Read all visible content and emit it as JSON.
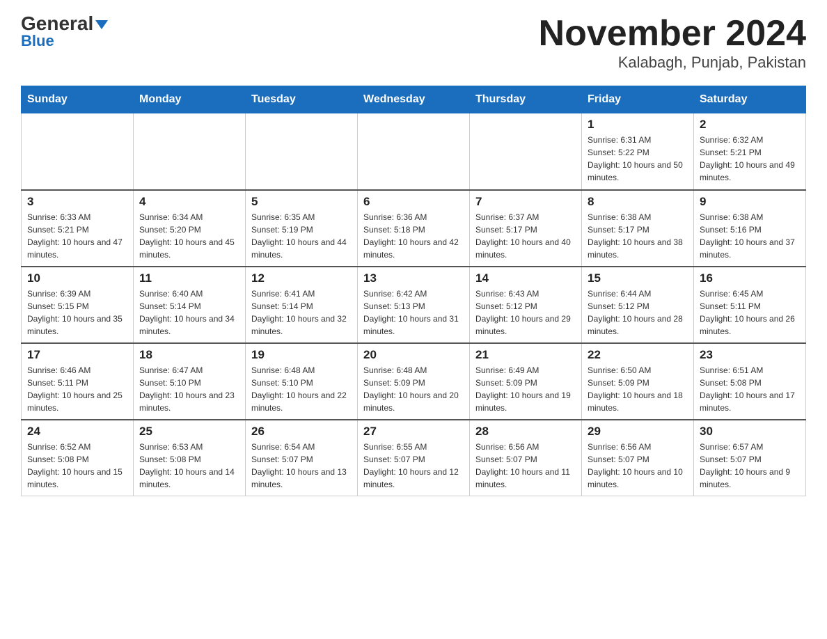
{
  "header": {
    "logo_general": "General",
    "logo_blue": "Blue",
    "title": "November 2024",
    "subtitle": "Kalabagh, Punjab, Pakistan"
  },
  "weekdays": [
    "Sunday",
    "Monday",
    "Tuesday",
    "Wednesday",
    "Thursday",
    "Friday",
    "Saturday"
  ],
  "weeks": [
    [
      {
        "day": "",
        "info": ""
      },
      {
        "day": "",
        "info": ""
      },
      {
        "day": "",
        "info": ""
      },
      {
        "day": "",
        "info": ""
      },
      {
        "day": "",
        "info": ""
      },
      {
        "day": "1",
        "info": "Sunrise: 6:31 AM\nSunset: 5:22 PM\nDaylight: 10 hours and 50 minutes."
      },
      {
        "day": "2",
        "info": "Sunrise: 6:32 AM\nSunset: 5:21 PM\nDaylight: 10 hours and 49 minutes."
      }
    ],
    [
      {
        "day": "3",
        "info": "Sunrise: 6:33 AM\nSunset: 5:21 PM\nDaylight: 10 hours and 47 minutes."
      },
      {
        "day": "4",
        "info": "Sunrise: 6:34 AM\nSunset: 5:20 PM\nDaylight: 10 hours and 45 minutes."
      },
      {
        "day": "5",
        "info": "Sunrise: 6:35 AM\nSunset: 5:19 PM\nDaylight: 10 hours and 44 minutes."
      },
      {
        "day": "6",
        "info": "Sunrise: 6:36 AM\nSunset: 5:18 PM\nDaylight: 10 hours and 42 minutes."
      },
      {
        "day": "7",
        "info": "Sunrise: 6:37 AM\nSunset: 5:17 PM\nDaylight: 10 hours and 40 minutes."
      },
      {
        "day": "8",
        "info": "Sunrise: 6:38 AM\nSunset: 5:17 PM\nDaylight: 10 hours and 38 minutes."
      },
      {
        "day": "9",
        "info": "Sunrise: 6:38 AM\nSunset: 5:16 PM\nDaylight: 10 hours and 37 minutes."
      }
    ],
    [
      {
        "day": "10",
        "info": "Sunrise: 6:39 AM\nSunset: 5:15 PM\nDaylight: 10 hours and 35 minutes."
      },
      {
        "day": "11",
        "info": "Sunrise: 6:40 AM\nSunset: 5:14 PM\nDaylight: 10 hours and 34 minutes."
      },
      {
        "day": "12",
        "info": "Sunrise: 6:41 AM\nSunset: 5:14 PM\nDaylight: 10 hours and 32 minutes."
      },
      {
        "day": "13",
        "info": "Sunrise: 6:42 AM\nSunset: 5:13 PM\nDaylight: 10 hours and 31 minutes."
      },
      {
        "day": "14",
        "info": "Sunrise: 6:43 AM\nSunset: 5:12 PM\nDaylight: 10 hours and 29 minutes."
      },
      {
        "day": "15",
        "info": "Sunrise: 6:44 AM\nSunset: 5:12 PM\nDaylight: 10 hours and 28 minutes."
      },
      {
        "day": "16",
        "info": "Sunrise: 6:45 AM\nSunset: 5:11 PM\nDaylight: 10 hours and 26 minutes."
      }
    ],
    [
      {
        "day": "17",
        "info": "Sunrise: 6:46 AM\nSunset: 5:11 PM\nDaylight: 10 hours and 25 minutes."
      },
      {
        "day": "18",
        "info": "Sunrise: 6:47 AM\nSunset: 5:10 PM\nDaylight: 10 hours and 23 minutes."
      },
      {
        "day": "19",
        "info": "Sunrise: 6:48 AM\nSunset: 5:10 PM\nDaylight: 10 hours and 22 minutes."
      },
      {
        "day": "20",
        "info": "Sunrise: 6:48 AM\nSunset: 5:09 PM\nDaylight: 10 hours and 20 minutes."
      },
      {
        "day": "21",
        "info": "Sunrise: 6:49 AM\nSunset: 5:09 PM\nDaylight: 10 hours and 19 minutes."
      },
      {
        "day": "22",
        "info": "Sunrise: 6:50 AM\nSunset: 5:09 PM\nDaylight: 10 hours and 18 minutes."
      },
      {
        "day": "23",
        "info": "Sunrise: 6:51 AM\nSunset: 5:08 PM\nDaylight: 10 hours and 17 minutes."
      }
    ],
    [
      {
        "day": "24",
        "info": "Sunrise: 6:52 AM\nSunset: 5:08 PM\nDaylight: 10 hours and 15 minutes."
      },
      {
        "day": "25",
        "info": "Sunrise: 6:53 AM\nSunset: 5:08 PM\nDaylight: 10 hours and 14 minutes."
      },
      {
        "day": "26",
        "info": "Sunrise: 6:54 AM\nSunset: 5:07 PM\nDaylight: 10 hours and 13 minutes."
      },
      {
        "day": "27",
        "info": "Sunrise: 6:55 AM\nSunset: 5:07 PM\nDaylight: 10 hours and 12 minutes."
      },
      {
        "day": "28",
        "info": "Sunrise: 6:56 AM\nSunset: 5:07 PM\nDaylight: 10 hours and 11 minutes."
      },
      {
        "day": "29",
        "info": "Sunrise: 6:56 AM\nSunset: 5:07 PM\nDaylight: 10 hours and 10 minutes."
      },
      {
        "day": "30",
        "info": "Sunrise: 6:57 AM\nSunset: 5:07 PM\nDaylight: 10 hours and 9 minutes."
      }
    ]
  ]
}
